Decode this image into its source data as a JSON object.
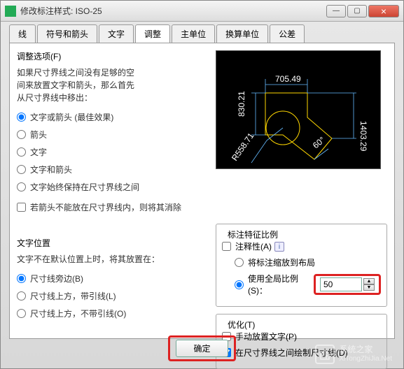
{
  "window": {
    "title": "修改标注样式: ISO-25",
    "min": "—",
    "max": "▢",
    "close": "×"
  },
  "tabs": {
    "t0": "线",
    "t1": "符号和箭头",
    "t2": "文字",
    "t3": "调整",
    "t4": "主单位",
    "t5": "换算单位",
    "t6": "公差"
  },
  "adjust": {
    "title": "调整选项(F)",
    "desc1": "如果尺寸界线之间没有足够的空",
    "desc2": "间来放置文字和箭头，那么首先",
    "desc3": "从尺寸界线中移出：",
    "o1": "文字或箭头 (最佳效果)",
    "o2": "箭头",
    "o3": "文字",
    "o4": "文字和箭头",
    "o5": "文字始终保持在尺寸界线之间",
    "cb1": "若箭头不能放在尺寸界线内，则将其消除"
  },
  "textpos": {
    "title": "文字位置",
    "desc": "文字不在默认位置上时，将其放置在：",
    "o1": "尺寸线旁边(B)",
    "o2": "尺寸线上方，带引线(L)",
    "o3": "尺寸线上方，不带引线(O)"
  },
  "scale": {
    "title": "标注特征比例",
    "ann": "注释性(A)",
    "r1": "将标注缩放到布局",
    "r2": "使用全局比例(S)：",
    "val": "50"
  },
  "opt": {
    "title": "优化(T)",
    "c1": "手动放置文字(P)",
    "c2": "在尺寸界线之间绘制尺寸线(D)"
  },
  "preview": {
    "d1": "705.49",
    "d2": "830.21",
    "d3": "1403.29",
    "d4": "60°",
    "d5": "R558.71"
  },
  "buttons": {
    "ok": "确定"
  },
  "watermark": {
    "main": "系统之家",
    "sub": "XiTongZhiJia.Net"
  }
}
